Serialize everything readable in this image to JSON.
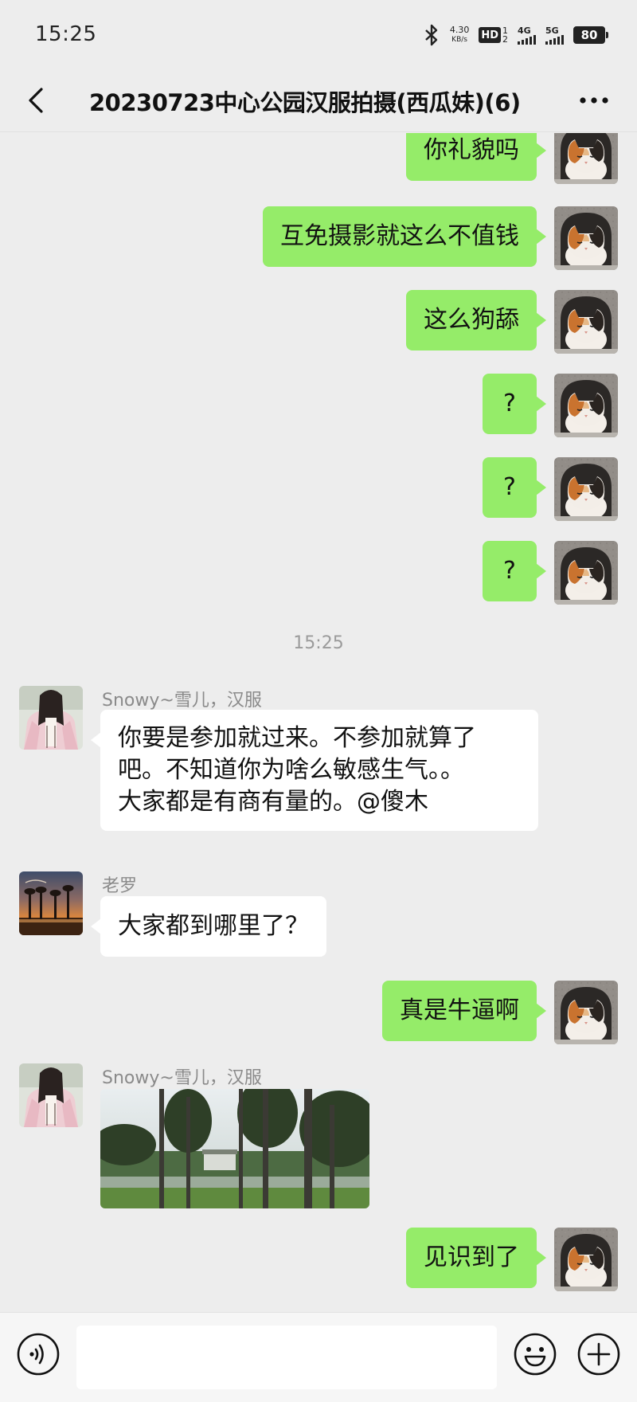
{
  "status_bar": {
    "time": "15:25",
    "net_speed_value": "4.30",
    "net_speed_unit": "KB/s",
    "hd_label": "HD",
    "hd_sub_top": "1",
    "hd_sub_bottom": "2",
    "signal_4g_label": "4G",
    "signal_5g_label": "5G",
    "battery": "80"
  },
  "header": {
    "title": "20230723中心公园汉服拍摄(西瓜妹)(6)"
  },
  "messages": [
    {
      "side": "me",
      "text": "你礼貌吗"
    },
    {
      "side": "me",
      "text": "互免摄影就这么不值钱"
    },
    {
      "side": "me",
      "text": "这么狗舔"
    },
    {
      "side": "me",
      "text": "?"
    },
    {
      "side": "me",
      "text": "?"
    },
    {
      "side": "me",
      "text": "?"
    },
    {
      "side": "divider",
      "text": "15:25"
    },
    {
      "side": "other",
      "sender": "Snowy~雪儿，汉服",
      "text_lines": [
        "你要是参加就过来。不参加就算了",
        "吧。不知道你为啥么敏感生气。。",
        "大家都是有商有量的。@傻木"
      ]
    },
    {
      "side": "other",
      "sender": "老罗",
      "text": "大家都到哪里了？"
    },
    {
      "side": "me",
      "text": "真是牛逼啊"
    },
    {
      "side": "other",
      "sender": "Snowy~雪儿，汉服",
      "image": "park-photo"
    },
    {
      "side": "me",
      "text": "见识到了"
    }
  ],
  "input_bar": {
    "placeholder": ""
  },
  "colors": {
    "my_bubble": "#95ec69",
    "other_bubble": "#ffffff",
    "background": "#ededed"
  },
  "icons": [
    "bluetooth-icon",
    "back-chevron-icon",
    "more-dots-icon",
    "voice-icon",
    "emoji-icon",
    "plus-icon"
  ]
}
